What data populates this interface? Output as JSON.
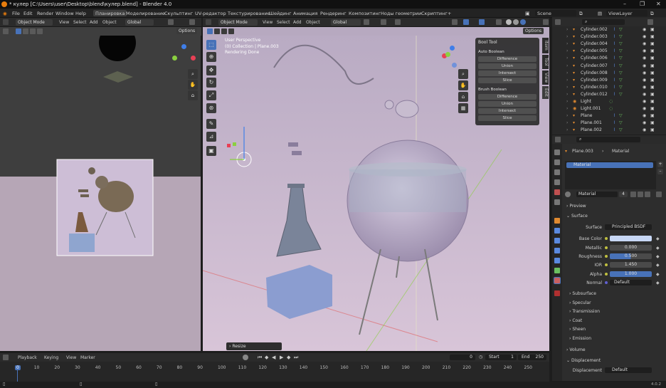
{
  "title": "* кулер [C:\\Users\\user\\Desktop\\blend\\кулер.blend] - Blender 4.0",
  "menu": [
    "File",
    "Edit",
    "Render",
    "Window",
    "Help"
  ],
  "workspaces": [
    "Планировка",
    "Моделирование",
    "Скульптинг",
    "UV-редактор",
    "Текстурирование",
    "Шейдинг",
    "Анимация",
    "Рендеринг",
    "Композитинг",
    "Ноды геометрии",
    "Скриптинг",
    "+"
  ],
  "scene": "Scene",
  "view_layer": "ViewLayer",
  "left_header": {
    "mode": "Object Mode",
    "menus": [
      "View",
      "Select",
      "Add",
      "Object"
    ],
    "orientation": "Global",
    "options": "Options"
  },
  "main_header": {
    "mode": "Object Mode",
    "menus": [
      "View",
      "Select",
      "Add",
      "Object"
    ],
    "orientation": "Global",
    "options": "Options"
  },
  "viewport_info": {
    "line1": "User Perspective",
    "line2": "(0) Collection | Plane.003",
    "line3": "Rendering Done"
  },
  "side_tabs": [
    "Item",
    "Tool",
    "View",
    "Edit"
  ],
  "bool_tool": {
    "title": "Bool Tool",
    "auto_header": "Auto Boolean",
    "auto": [
      "Difference",
      "Union",
      "Intersect",
      "Slice"
    ],
    "brush_header": "Brush Boolean",
    "brush": [
      "Difference",
      "Union",
      "Intersect",
      "Slice"
    ]
  },
  "resize_panel": "Resize",
  "outliner": [
    "Cylinder.002",
    "Cylinder.003",
    "Cylinder.004",
    "Cylinder.005",
    "Cylinder.006",
    "Cylinder.007",
    "Cylinder.008",
    "Cylinder.009",
    "Cylinder.010",
    "Cylinder.012",
    "Light",
    "Light.001",
    "Plane",
    "Plane.001",
    "Plane.002"
  ],
  "props": {
    "breadcrumb_object": "Plane.003",
    "breadcrumb_tab": "Material",
    "slot": "Material",
    "material_name": "Material",
    "users": "4",
    "preview": "Preview",
    "surface_header": "Surface",
    "surface_label": "Surface",
    "surface_value": "Principled BSDF",
    "fields": [
      {
        "label": "Base Color",
        "value": ""
      },
      {
        "label": "Metallic",
        "value": "0.000"
      },
      {
        "label": "Roughness",
        "value": "0.500"
      },
      {
        "label": "IOR",
        "value": "1.450"
      },
      {
        "label": "Alpha",
        "value": "1.000"
      },
      {
        "label": "Normal",
        "value": "Default"
      }
    ],
    "subsections": [
      "Subsurface",
      "Specular",
      "Transmission",
      "Coat",
      "Sheen",
      "Emission"
    ],
    "volume": "Volume",
    "displacement_header": "Displacement",
    "displacement_label": "Displacement",
    "displacement_value": "Default"
  },
  "timeline": {
    "menus": [
      "Playback",
      "Keying",
      "View",
      "Marker"
    ],
    "current": "0",
    "start_label": "Start",
    "start": "1",
    "end_label": "End",
    "end": "250",
    "ticks": [
      "0",
      "10",
      "20",
      "30",
      "40",
      "50",
      "60",
      "70",
      "80",
      "90",
      "100",
      "110",
      "120",
      "130",
      "140",
      "150",
      "160",
      "170",
      "180",
      "190",
      "200",
      "210",
      "220",
      "230",
      "240",
      "250"
    ]
  },
  "version": "4.0.2",
  "colors": {
    "accent": "#4872b8",
    "bg": "#1d1d1d",
    "orange": "#e87d0d"
  }
}
